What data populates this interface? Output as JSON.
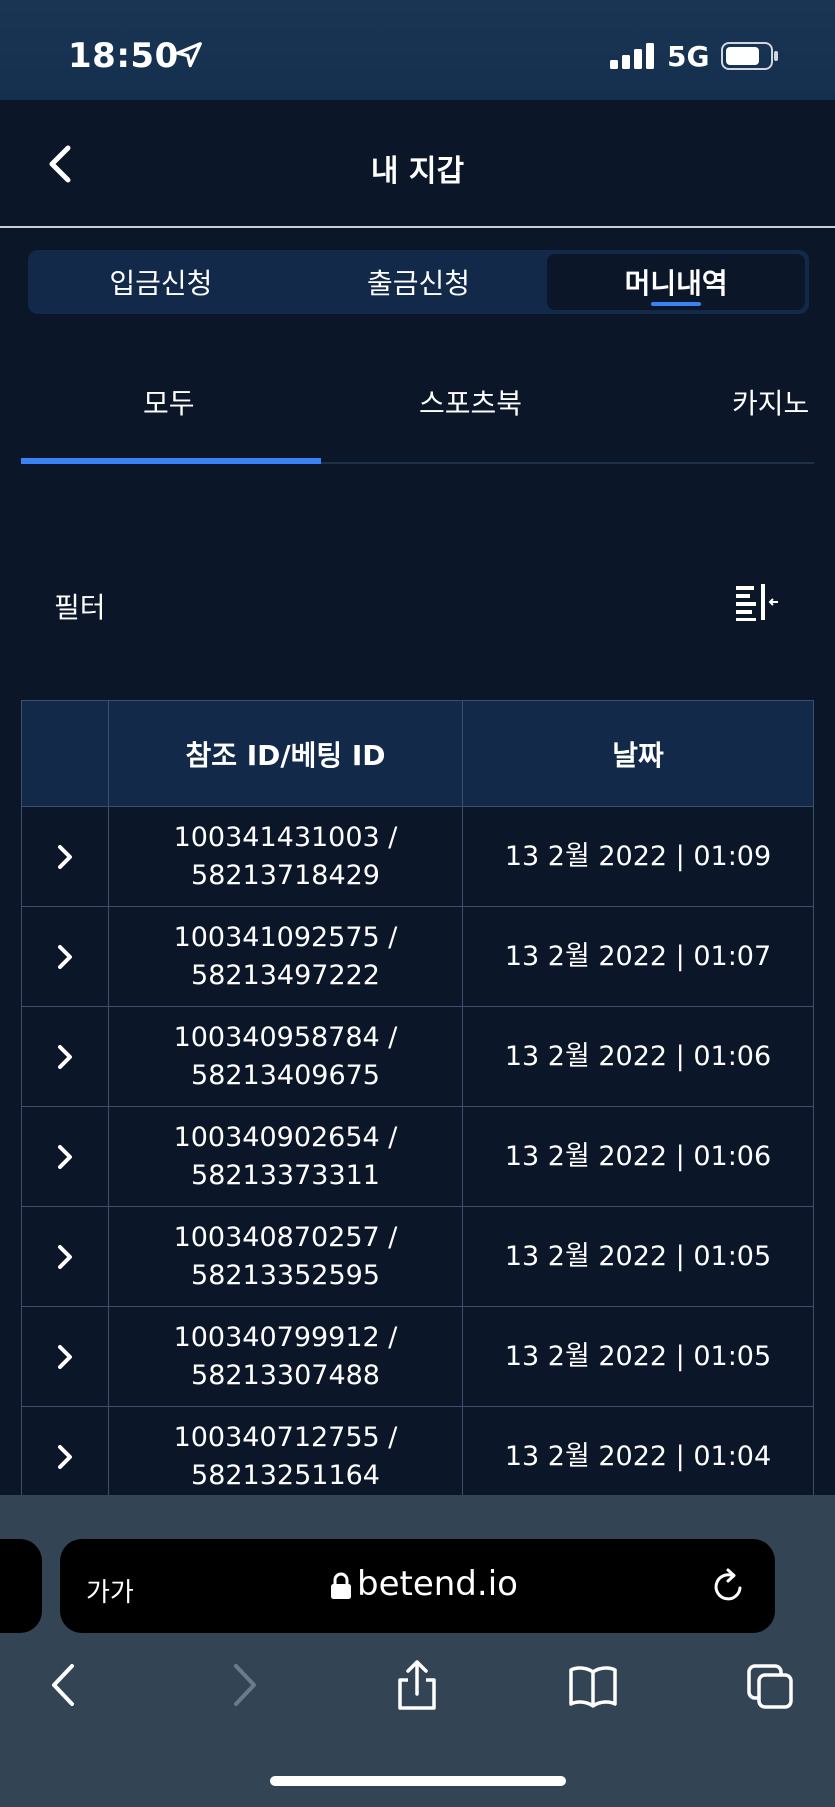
{
  "status_bar": {
    "time": "18:50",
    "network": "5G"
  },
  "header": {
    "title": "내 지갑"
  },
  "segment_tabs": [
    {
      "label": "입금신청",
      "active": false
    },
    {
      "label": "출금신청",
      "active": false
    },
    {
      "label": "머니내역",
      "active": true
    }
  ],
  "category_tabs": [
    {
      "label": "모두",
      "active": true
    },
    {
      "label": "스포츠북",
      "active": false
    },
    {
      "label": "카지노",
      "active": false
    }
  ],
  "filter": {
    "label": "필터",
    "icon": "filter-sort-icon"
  },
  "table": {
    "headers": [
      "",
      "참조 ID/베팅 ID",
      "날짜"
    ],
    "rows": [
      {
        "ref_id": "100341431003 /",
        "bet_id": "58213718429",
        "date": "13 2월 2022 | 01:09"
      },
      {
        "ref_id": "100341092575 /",
        "bet_id": "58213497222",
        "date": "13 2월 2022 | 01:07"
      },
      {
        "ref_id": "100340958784 /",
        "bet_id": "58213409675",
        "date": "13 2월 2022 | 01:06"
      },
      {
        "ref_id": "100340902654 /",
        "bet_id": "58213373311",
        "date": "13 2월 2022 | 01:06"
      },
      {
        "ref_id": "100340870257 /",
        "bet_id": "58213352595",
        "date": "13 2월 2022 | 01:05"
      },
      {
        "ref_id": "100340799912 /",
        "bet_id": "58213307488",
        "date": "13 2월 2022 | 01:05"
      },
      {
        "ref_id": "100340712755 /",
        "bet_id": "58213251164",
        "date": "13 2월 2022 | 01:04"
      }
    ]
  },
  "browser": {
    "text_size_label": "가가",
    "domain": "betend.io"
  },
  "colors": {
    "background": "#0b1628",
    "panel": "#13294a",
    "accent": "#3b82f6",
    "border": "#3d4f6b",
    "browser_chrome": "#334555"
  }
}
